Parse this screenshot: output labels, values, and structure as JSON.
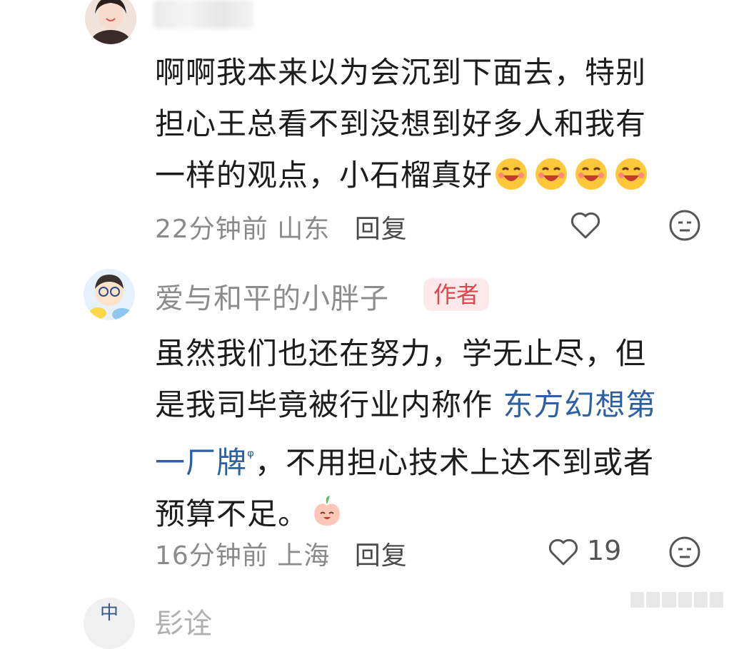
{
  "comments": [
    {
      "text_lines": [
        "啊啊我本来以为会沉到下面去，特别",
        "担心王总看不到没想到好多人和我有",
        "一样的观点，小石榴真好"
      ],
      "emoji_count": 4,
      "time": "22分钟前",
      "location": "山东",
      "reply_label": "回复"
    },
    {
      "username": "爱与和平的小胖子",
      "badge": "作者",
      "line1": "虽然我们也还在努力，学无止尽，但",
      "line2_prefix": "是我司毕竟被行业内称作 ",
      "link_text_a": "东方幻想第",
      "link_text_b": "一厂牌",
      "line3_suffix": "，不用担心技术上达不到或者",
      "line4": "预算不足。",
      "time": "16分钟前",
      "location": "上海",
      "reply_label": "回复",
      "like_count": "19"
    },
    {
      "username": "髟诠"
    }
  ]
}
